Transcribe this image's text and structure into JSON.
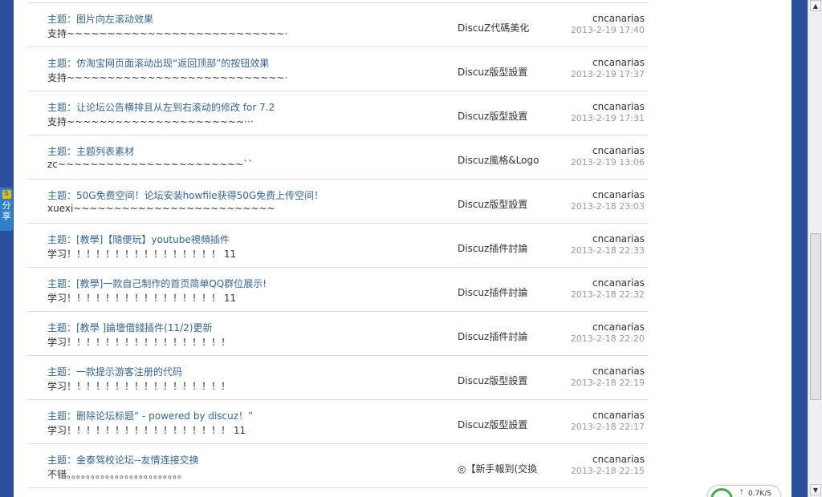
{
  "threads": [
    {
      "subject": "主题：图片向左滚动效果",
      "reply": "支持~~~~~~~~~~~~~~~~~~~~~~~~~~~·",
      "forum": "DiscuZ代碼美化",
      "author": "cncanarias",
      "time": "2013-2-19 17:40"
    },
    {
      "subject": "主题：仿淘宝网页面滚动出现“返回顶部”的按钮效果",
      "reply": "支持~~~~~~~~~~~~~~~~~~~~~~~~~~~·",
      "forum": "Discuz版型設置",
      "author": "cncanarias",
      "time": "2013-2-19 17:37"
    },
    {
      "subject": "主题：让论坛公告横排且从左到右滚动的修改 for 7.2",
      "reply": "支持~~~~~~~~~~~~~~~~~~~~~~···",
      "forum": "Discuz版型設置",
      "author": "cncanarias",
      "time": "2013-2-19 17:31"
    },
    {
      "subject": "主题：主题列表素材",
      "reply": "zc~~~~~~~~~~~~~~~~~~~~~~~``",
      "forum": "Discuz風格&Logo",
      "author": "cncanarias",
      "time": "2013-2-19 13:06"
    },
    {
      "subject": "主题：50G免费空间！论坛安装howfile获得50G免费上传空间！",
      "reply": "xuexi~~~~~~~~~~~~~~~~~~~~~~~~~",
      "forum": "Discuz版型設置",
      "author": "cncanarias",
      "time": "2013-2-18 23:03"
    },
    {
      "subject": "主题：[教學]【隨便玩】youtube視頻插件",
      "reply": "学习！！！！！！！！！！！！！！！！ 11",
      "forum": "Discuz插件討論",
      "author": "cncanarias",
      "time": "2013-2-18 22:33"
    },
    {
      "subject": "主题：[教學]一款自己制作的首页简单QQ群位展示!",
      "reply": "学习！！！！！！！！！！！！！！！！ 11",
      "forum": "Discuz插件討論",
      "author": "cncanarias",
      "time": "2013-2-18 22:32"
    },
    {
      "subject": "主题：[教學 ]論壇借錢插件(11/2)更新",
      "reply": "学习！！！！！！！！！！！！！！！！！",
      "forum": "Discuz插件討論",
      "author": "cncanarias",
      "time": "2013-2-18 22:20"
    },
    {
      "subject": "主题：一款提示游客注册的代码",
      "reply": "学习！！！！！！！！！！！！！！！！！",
      "forum": "Discuz版型設置",
      "author": "cncanarias",
      "time": "2013-2-18 22:19"
    },
    {
      "subject": "主题：删除论坛标题“ - powered by discuz！”",
      "reply": "学习！！！！！！！！！！！！！！！！！ 11",
      "forum": "Discuz版型設置",
      "author": "cncanarias",
      "time": "2013-2-18 22:17"
    },
    {
      "subject": "主题：金泰驾校论坛--友情连接交换",
      "reply": "不错。。。。。。。。。。。。。。。。。。。。。。。。",
      "forum": "◎【新手報到(交換",
      "author": "cncanarias",
      "time": "2013-2-18 22:15"
    }
  ],
  "share_tab": {
    "logo": "S",
    "chars": [
      "分",
      "享"
    ]
  },
  "speed_widget": {
    "text": "0.7K/S"
  },
  "colors": {
    "side_band": "#2b4f9a",
    "subject_link": "#336699",
    "time_gray": "#999999"
  }
}
